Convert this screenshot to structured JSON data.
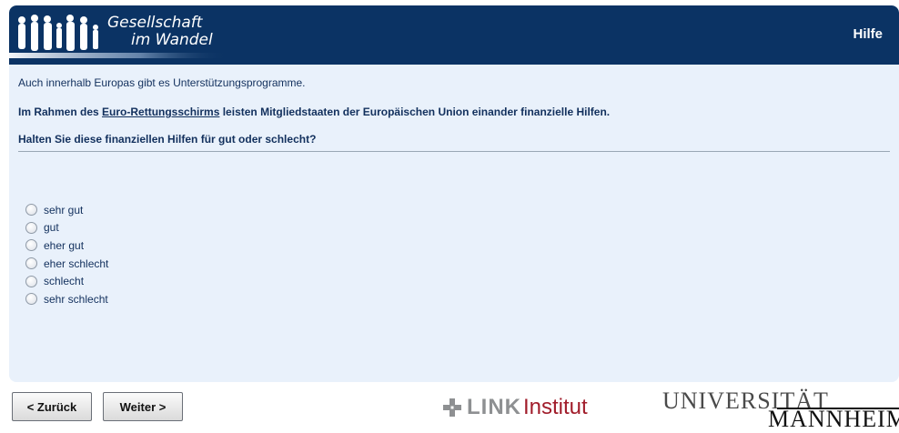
{
  "header": {
    "logo_line1": "Gesellschaft",
    "logo_line2": "im Wandel",
    "help_label": "Hilfe"
  },
  "survey": {
    "intro": "Auch innerhalb Europas gibt es Unterstützungsprogramme.",
    "statement_before": "Im Rahmen des ",
    "statement_link": "Euro-Rettungsschirms",
    "statement_after": " leisten Mitgliedstaaten der Europäischen Union einander finanzielle Hilfen.",
    "question": "Halten Sie diese finanziellen Hilfen für gut oder schlecht?",
    "options": [
      "sehr gut",
      "gut",
      "eher gut",
      "eher schlecht",
      "schlecht",
      "sehr schlecht"
    ]
  },
  "footer": {
    "back_label": "< Zurück",
    "next_label": "Weiter >",
    "link_word": "LINK",
    "link_institut": "Institut",
    "uni_line1": "UNIVERSITÄT",
    "uni_line2": "MANNHEIM"
  },
  "colors": {
    "header_bg": "#0b3364",
    "panel_bg": "#e9f1fb",
    "text": "#12305d",
    "link_red": "#a11d2b"
  }
}
